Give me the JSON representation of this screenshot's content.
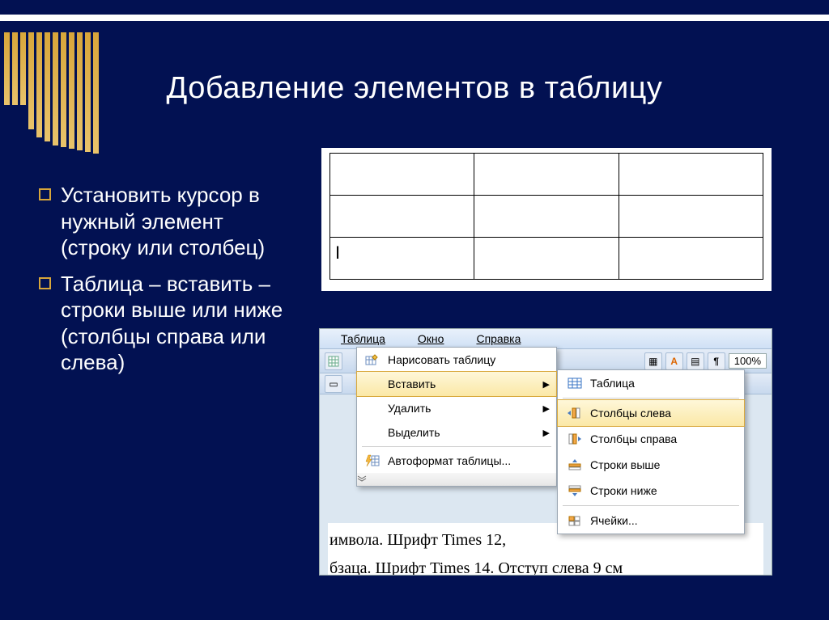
{
  "slide": {
    "title": "Добавление элементов в таблицу",
    "bullets": [
      "Установить курсор в нужный элемент (строку или столбец)",
      "Таблица – вставить – строки выше или ниже (столбцы справа или слева)"
    ]
  },
  "sample_table": {
    "cursor_cell_text": "I"
  },
  "menubar": {
    "items": [
      "Таблица",
      "Окно",
      "Справка"
    ]
  },
  "toolbar": {
    "zoom": "100%"
  },
  "dropdown": {
    "items": [
      {
        "label": "Нарисовать таблицу",
        "icon": "pencil-table",
        "has_submenu": false,
        "underline": "Н"
      },
      {
        "label": "Вставить",
        "icon": "",
        "has_submenu": true,
        "highlight": true,
        "underline": "В"
      },
      {
        "label": "Удалить",
        "icon": "",
        "has_submenu": true,
        "underline": "У"
      },
      {
        "label": "Выделить",
        "icon": "",
        "has_submenu": true,
        "underline": "ы"
      },
      {
        "label": "Автоформат таблицы...",
        "icon": "lightning",
        "has_submenu": false,
        "underline": "А"
      }
    ]
  },
  "submenu": {
    "items": [
      {
        "label": "Таблица",
        "icon": "table",
        "underline": "Т"
      },
      {
        "label": "Столбцы слева",
        "icon": "col-left",
        "highlight": true,
        "underline": "л"
      },
      {
        "label": "Столбцы справа",
        "icon": "col-right",
        "underline": "п"
      },
      {
        "label": "Строки выше",
        "icon": "row-above",
        "underline": "в"
      },
      {
        "label": "Строки ниже",
        "icon": "row-below",
        "underline": "н"
      },
      {
        "label": "Ячейки...",
        "icon": "cells",
        "underline": "Я"
      }
    ]
  },
  "doc_bg": {
    "line1": "имвола. Шрифт Times 12,",
    "line2": "бзаца. Шрифт Times 14. Отступ слева 9 см"
  }
}
